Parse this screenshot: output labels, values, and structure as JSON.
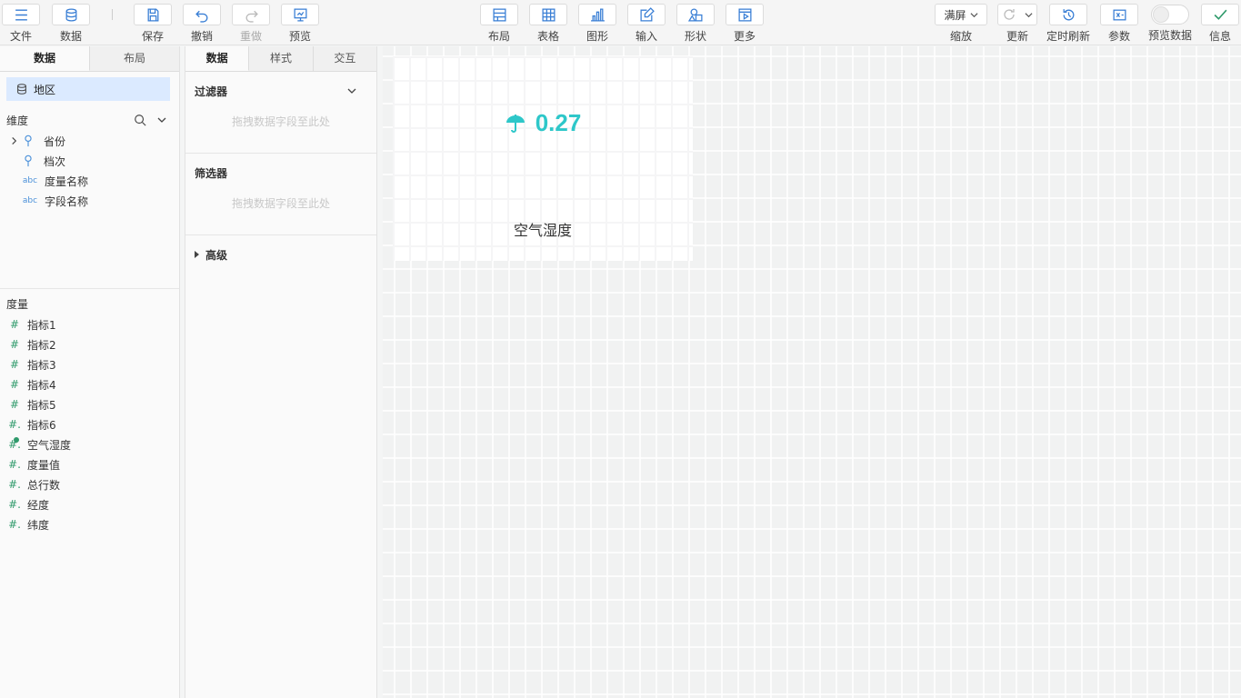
{
  "toolbar": {
    "file": "文件",
    "data": "数据",
    "save": "保存",
    "undo": "撤销",
    "redo": "重做",
    "preview": "预览",
    "layout": "布局",
    "table": "表格",
    "chart": "图形",
    "input": "输入",
    "shape": "形状",
    "more": "更多",
    "zoom_value": "满屏",
    "zoom": "缩放",
    "refresh": "更新",
    "timed_refresh": "定时刷新",
    "params": "参数",
    "preview_data": "预览数据",
    "info": "信息"
  },
  "left_panel": {
    "tabs": [
      "数据",
      "布局"
    ],
    "dataset": "地区",
    "dimensions_title": "维度",
    "dimensions": [
      "省份",
      "档次",
      "度量名称",
      "字段名称"
    ],
    "measures_title": "度量",
    "measures": [
      "指标1",
      "指标2",
      "指标3",
      "指标4",
      "指标5",
      "指标6",
      "空气湿度",
      "度量值",
      "总行数",
      "经度",
      "纬度"
    ]
  },
  "mid_panel": {
    "tabs": [
      "数据",
      "样式",
      "交互"
    ],
    "filter_title": "过滤器",
    "filter_hint": "拖拽数据字段至此处",
    "selector_title": "筛选器",
    "selector_hint": "拖拽数据字段至此处",
    "advanced_title": "高级"
  },
  "canvas": {
    "kpi_value": "0.27",
    "kpi_label": "空气湿度",
    "kpi_color": "#2ec7c9"
  }
}
